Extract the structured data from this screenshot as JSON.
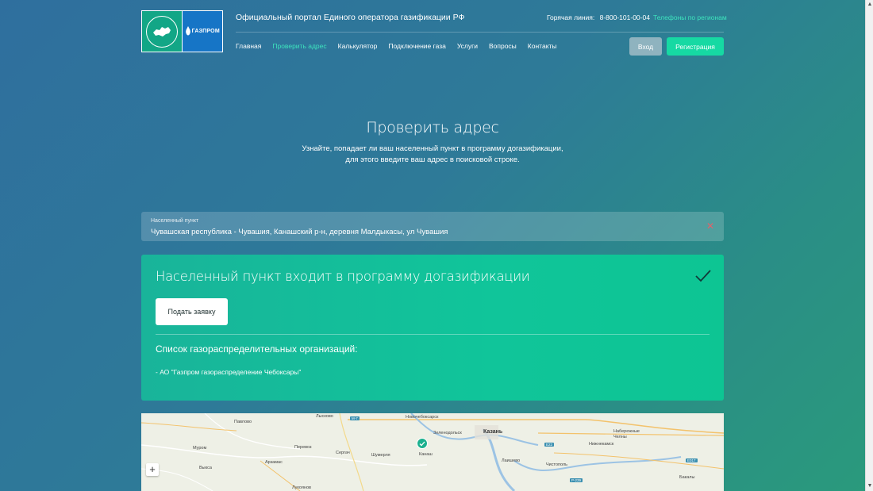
{
  "header": {
    "portal_title": "Официальный портал Единого оператора газификации РФ",
    "hotline_label": "Горячая линия:",
    "hotline_number": "8-800-101-00-04",
    "regions_link": "Телефоны по регионам",
    "logo_right_text": "ГАЗПРОМ",
    "login_button": "Вход",
    "register_button": "Регистрация"
  },
  "nav": {
    "items": [
      "Главная",
      "Проверить адрес",
      "Калькулятор",
      "Подключение газа",
      "Услуги",
      "Вопросы",
      "Контакты"
    ],
    "active": "Проверить адрес"
  },
  "hero": {
    "title": "Проверить адрес",
    "subtitle_line1": "Узнайте, попадает ли ваш населенный пункт в программу догазификации,",
    "subtitle_line2": "для этого введите ваш адрес в поисковой строке."
  },
  "search": {
    "label": "Населенный пункт",
    "value": "Чувашская республика - Чувашия, Канашский р-н, деревня Малдыкасы, ул Чувашия",
    "clear_icon": "close-icon"
  },
  "result": {
    "title": "Населенный пункт входит в программу догазификации",
    "status_icon": "checkmark-icon",
    "apply_button": "Подать заявку",
    "orgs_title": "Список газораспределительных организаций:",
    "orgs": [
      "- АО \"Газпром газораспределение Чебоксары\""
    ]
  },
  "map": {
    "labels": {
      "pavlovo": "Павлово",
      "lyskovo": "Лысково",
      "novocheboksarsk": "Новочебоксарск",
      "zelenodolsk": "Зеленодольск",
      "kazan": "Казань",
      "naberezhnye_chelny": "Набережные Челны",
      "nizhnekamsk": "Нижнекамск",
      "murom": "Муром",
      "perevoz": "Перевоз",
      "sergach": "Сергач",
      "shumerlya": "Шумерля",
      "kanash": "Канаш",
      "laishevo": "Лаишево",
      "chistopol": "Чистополь",
      "arzamas": "Арзамас",
      "vyksa": "Выкса",
      "lukoyanov": "Лукоянов",
      "bakaly": "Бакалы"
    },
    "roads": {
      "m7": "M-7",
      "e22": "E22",
      "e017": "E017",
      "r239": "Р-239"
    },
    "zoom_in": "+"
  }
}
